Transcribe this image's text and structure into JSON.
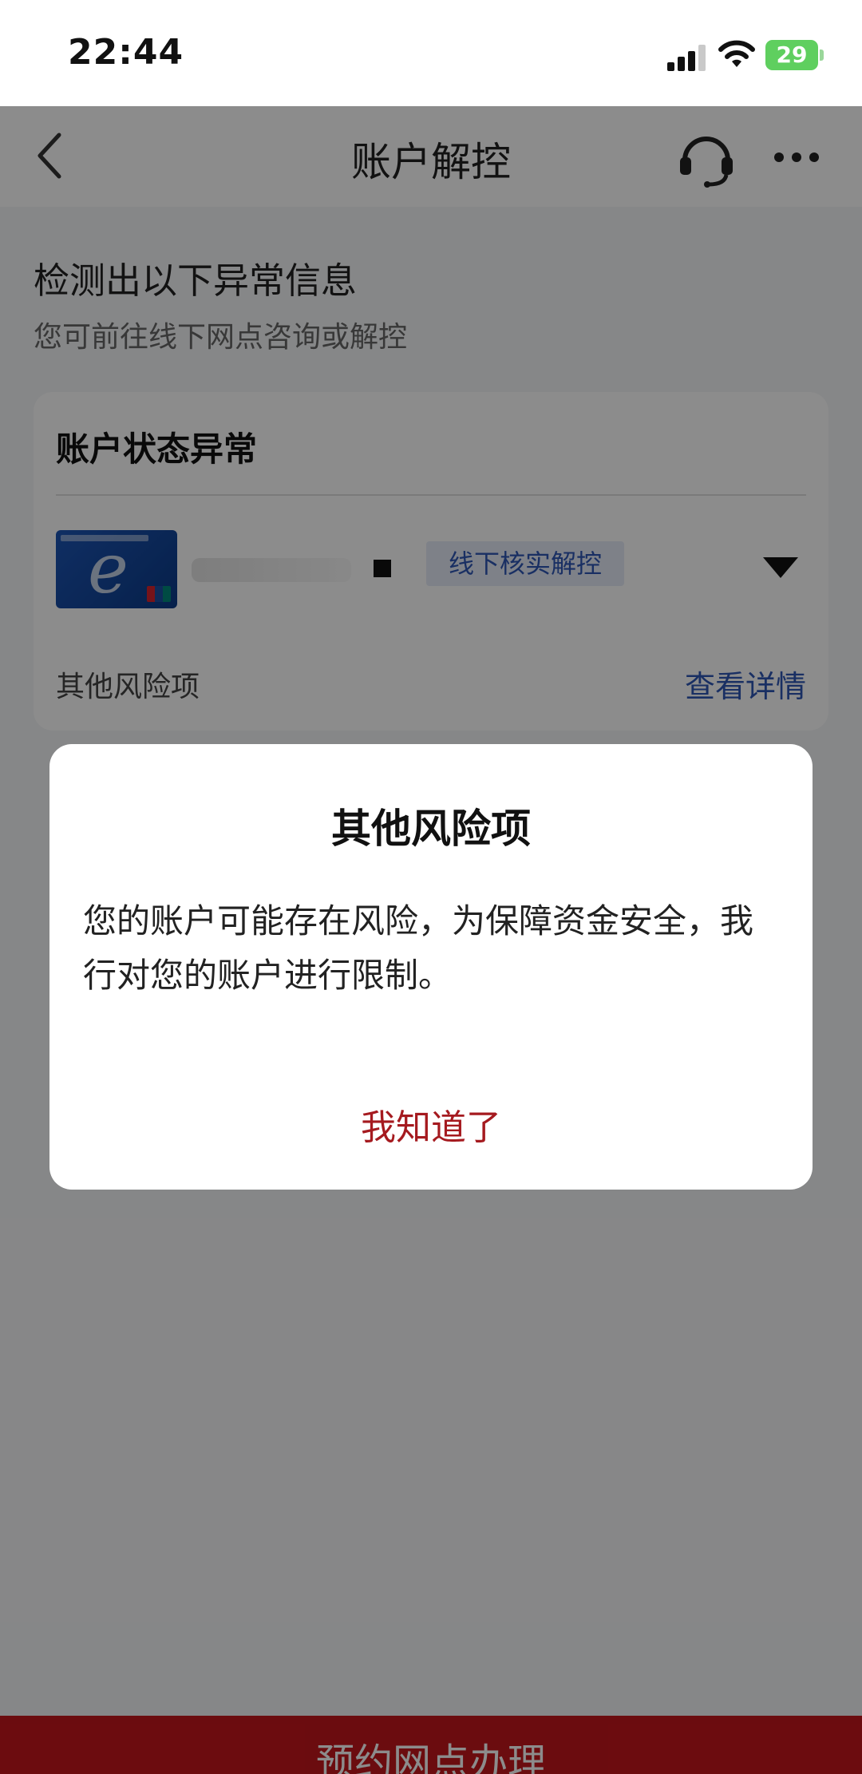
{
  "status_bar": {
    "time": "22:44",
    "battery": "29"
  },
  "nav": {
    "title": "账户解控",
    "icons": [
      "back-icon",
      "headset-icon",
      "more-icon"
    ]
  },
  "content": {
    "headline": "检测出以下异常信息",
    "subline": "您可前往线下网点咨询或解控",
    "card": {
      "title": "账户状态异常",
      "status_tag": "线下核实解控",
      "other_risk_label": "其他风险项",
      "view_details": "查看详情"
    }
  },
  "bottom_button": {
    "label": "预约网点办理"
  },
  "dialog": {
    "title": "其他风险项",
    "message": "您的账户可能存在风险，为保障资金安全，我行对您的账户进行限制。",
    "button": "我知道了"
  },
  "colors": {
    "accent_red": "#c4161c",
    "link_blue": "#2e57b5",
    "dialog_button": "#a51a1f"
  }
}
